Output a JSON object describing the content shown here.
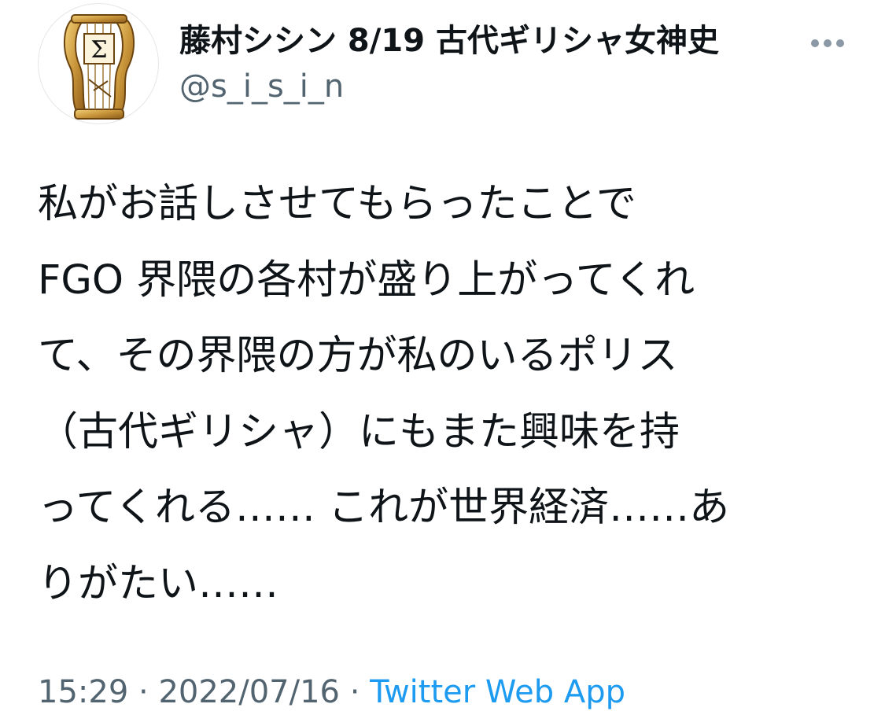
{
  "author": {
    "display_name": "藤村シシン 8/19 古代ギリシャ女神史",
    "handle": "@s_i_s_i_n",
    "avatar_icon": "lyre-sigma-icon"
  },
  "header": {
    "more_icon": "more-horizontal-icon"
  },
  "tweet": {
    "lines": [
      "私がお話しさせてもらったことで",
      "FGO 界隈の各村が盛り上がってくれ",
      "て、その界隈の方が私のいるポリス",
      "（古代ギリシャ）にもまた興味を持",
      "ってくれる…… これが世界経済……あ",
      "りがたい……"
    ]
  },
  "meta": {
    "time": "15:29",
    "separator": " · ",
    "date": "2022/07/16",
    "source": "Twitter Web App"
  },
  "colors": {
    "text": "#0f1419",
    "secondary": "#536471",
    "link": "#1d9bf0",
    "avatar_gold": "#c9953a"
  }
}
